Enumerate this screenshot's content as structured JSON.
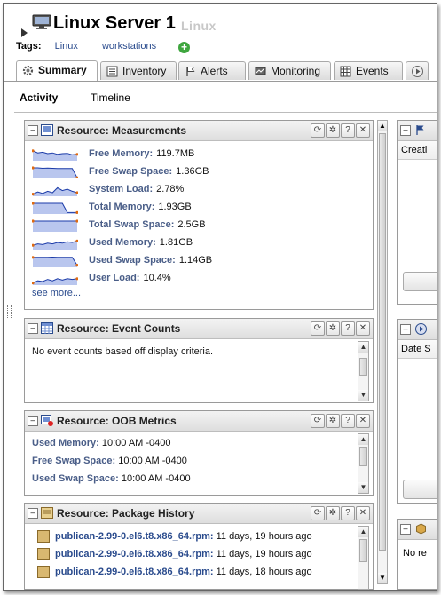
{
  "header": {
    "title": "Linux Server 1",
    "subtitle": "Linux",
    "tags_label": "Tags:",
    "tags": [
      "Linux",
      "workstations"
    ]
  },
  "tabs": [
    {
      "label": "Summary",
      "icon": "gear-icon",
      "active": true
    },
    {
      "label": "Inventory",
      "icon": "inventory-icon",
      "active": false
    },
    {
      "label": "Alerts",
      "icon": "flag-icon",
      "active": false
    },
    {
      "label": "Monitoring",
      "icon": "monitoring-icon",
      "active": false
    },
    {
      "label": "Events",
      "icon": "events-icon",
      "active": false
    }
  ],
  "subtabs": [
    {
      "label": "Activity",
      "active": true
    },
    {
      "label": "Timeline",
      "active": false
    }
  ],
  "measurements": {
    "title": "Resource: Measurements",
    "items": [
      {
        "label": "Free Memory:",
        "value": "119.7MB"
      },
      {
        "label": "Free Swap Space:",
        "value": "1.36GB"
      },
      {
        "label": "System Load:",
        "value": "2.78%"
      },
      {
        "label": "Total Memory:",
        "value": "1.93GB"
      },
      {
        "label": "Total Swap Space:",
        "value": "2.5GB"
      },
      {
        "label": "Used Memory:",
        "value": "1.81GB"
      },
      {
        "label": "Used Swap Space:",
        "value": "1.14GB"
      },
      {
        "label": "User Load:",
        "value": "10.4%"
      }
    ],
    "see_more": "see more..."
  },
  "event_counts": {
    "title": "Resource: Event Counts",
    "message": "No event counts based off display criteria."
  },
  "oob": {
    "title": "Resource: OOB Metrics",
    "items": [
      {
        "label": "Used Memory:",
        "value": "10:00 AM -0400"
      },
      {
        "label": "Free Swap Space:",
        "value": "10:00 AM -0400"
      },
      {
        "label": "Used Swap Space:",
        "value": "10:00 AM -0400"
      }
    ]
  },
  "package_history": {
    "title": "Resource: Package History",
    "items": [
      {
        "name": "publican-2.99-0.el6.t8.x86_64.rpm:",
        "age": "11 days, 19 hours ago"
      },
      {
        "name": "publican-2.99-0.el6.t8.x86_64.rpm:",
        "age": "11 days, 19 hours ago"
      },
      {
        "name": "publican-2.99-0.el6.t8.x86_64.rpm:",
        "age": "11 days, 18 hours ago"
      }
    ]
  },
  "right_panels": {
    "top_column": "Creati",
    "mid_column": "Date S",
    "bottom_text": "No re"
  },
  "colors": {
    "label_blue": "#4a5e88",
    "link_blue": "#2a4b8d",
    "spark_fill": "#b9c6ee",
    "spark_line": "#1a3aa8",
    "spark_marker": "#e06a10"
  }
}
